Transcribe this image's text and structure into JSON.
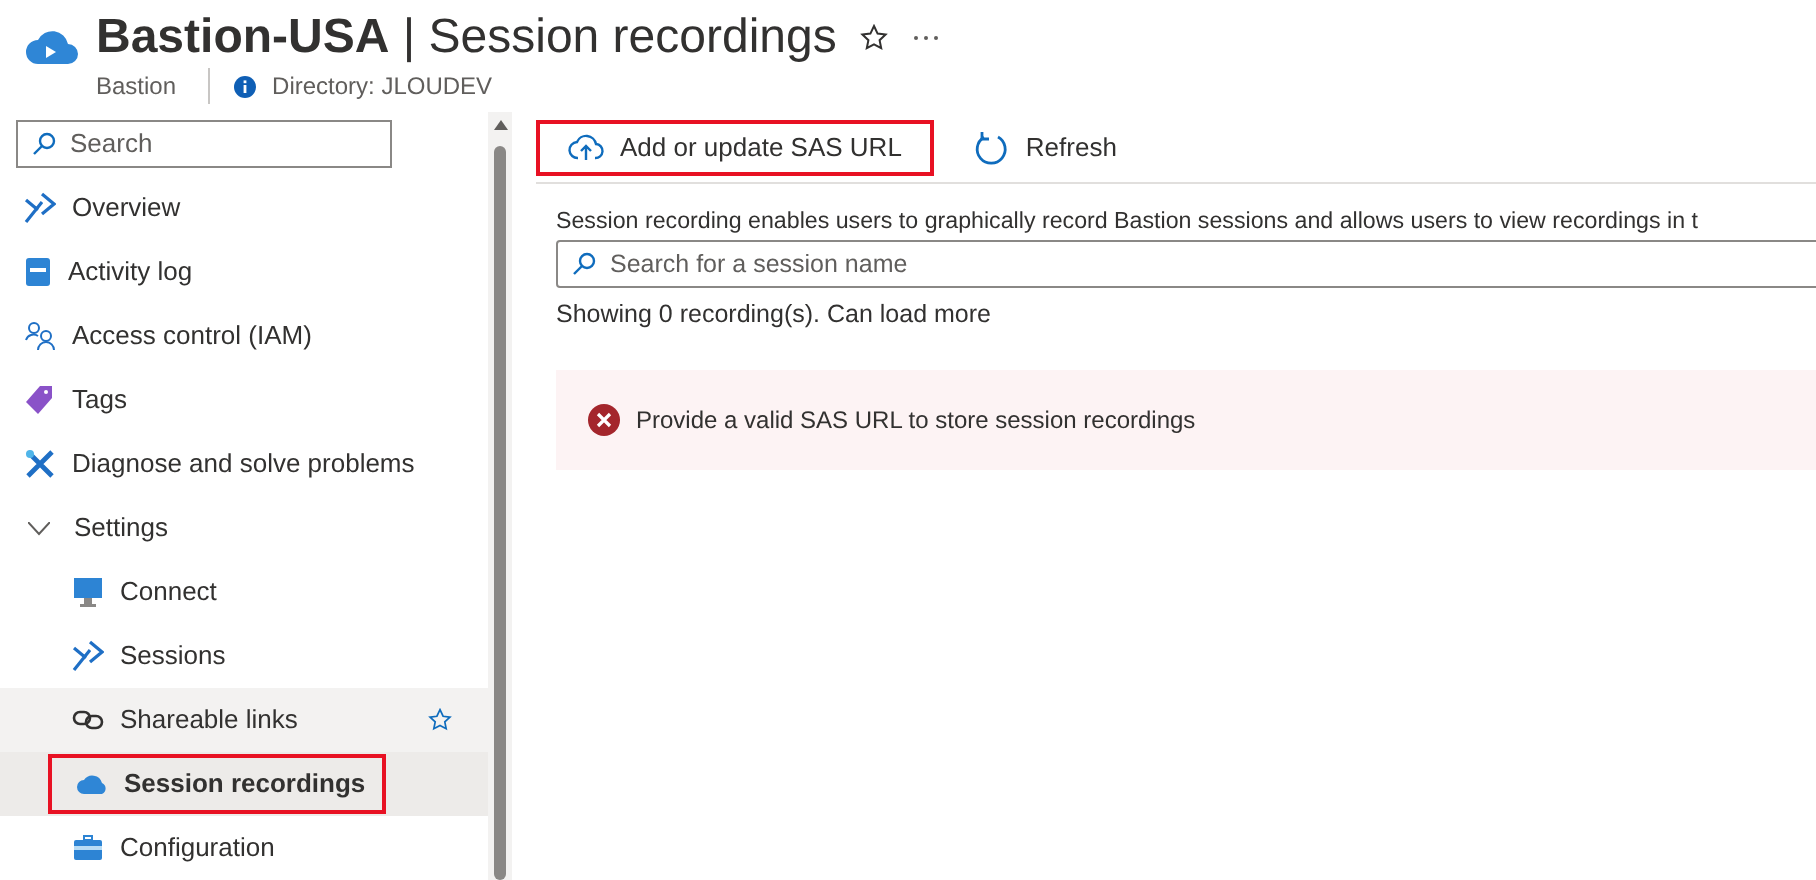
{
  "header": {
    "title": "Bastion-USA",
    "separator": "|",
    "subtitle": "Session recordings",
    "resource_type": "Bastion",
    "directory": "Directory: JLOUDEV"
  },
  "sidebar": {
    "search": {
      "placeholder": "Search"
    },
    "items": [
      {
        "label": "Overview",
        "kind": "item",
        "selected": false,
        "hovered": false,
        "favorite": false,
        "annotated": false
      },
      {
        "label": "Activity log",
        "kind": "item",
        "selected": false,
        "hovered": false,
        "favorite": false,
        "annotated": false
      },
      {
        "label": "Access control (IAM)",
        "kind": "item",
        "selected": false,
        "hovered": false,
        "favorite": false,
        "annotated": false
      },
      {
        "label": "Tags",
        "kind": "item",
        "selected": false,
        "hovered": false,
        "favorite": false,
        "annotated": false
      },
      {
        "label": "Diagnose and solve problems",
        "kind": "item",
        "selected": false,
        "hovered": false,
        "favorite": false,
        "annotated": false
      },
      {
        "label": "Settings",
        "kind": "group",
        "expanded": true,
        "children": [
          {
            "label": "Connect",
            "kind": "item",
            "selected": false,
            "hovered": false,
            "favorite": false,
            "annotated": false
          },
          {
            "label": "Sessions",
            "kind": "item",
            "selected": false,
            "hovered": false,
            "favorite": false,
            "annotated": false
          },
          {
            "label": "Shareable links",
            "kind": "item",
            "selected": false,
            "hovered": true,
            "favorite": true,
            "annotated": false
          },
          {
            "label": "Session recordings",
            "kind": "item",
            "selected": true,
            "hovered": false,
            "favorite": false,
            "annotated": true
          },
          {
            "label": "Configuration",
            "kind": "item",
            "selected": false,
            "hovered": false,
            "favorite": false,
            "annotated": false
          }
        ]
      }
    ]
  },
  "toolbar": [
    {
      "label": "Add or update SAS URL",
      "kind": "upload",
      "annotated": true
    },
    {
      "label": "Refresh",
      "kind": "refresh",
      "annotated": false
    }
  ],
  "description": "Session recording enables users to graphically record Bastion sessions and allows users to view recordings in t",
  "session_search": {
    "placeholder": "Search for a session name"
  },
  "count_text": "Showing 0 recording(s). Can load more",
  "alert": {
    "kind": "error",
    "message": "Provide a valid SAS URL to store session recordings"
  }
}
